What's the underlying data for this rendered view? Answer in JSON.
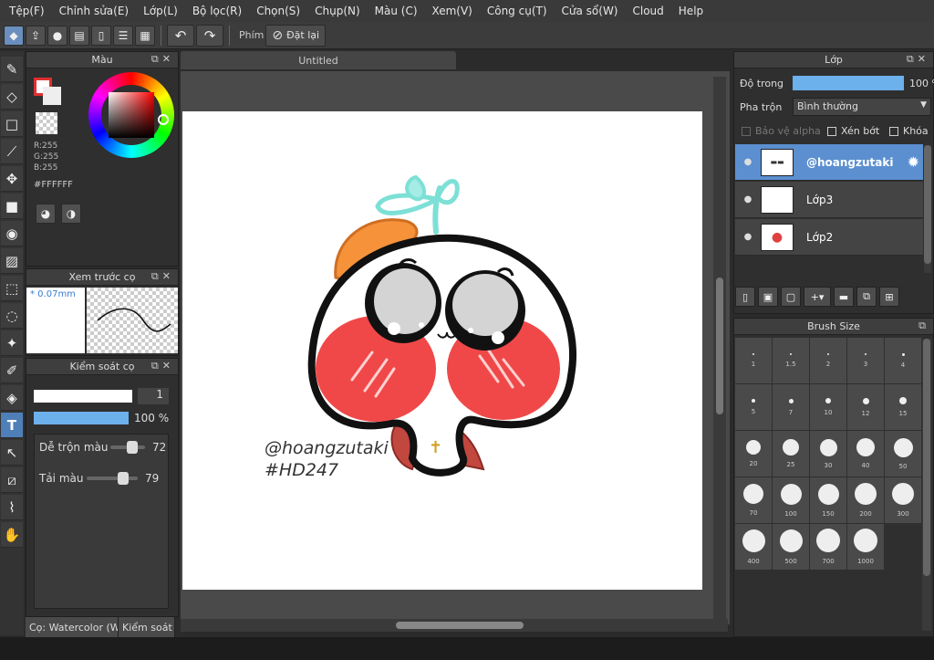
{
  "menu": [
    "Tệp(F)",
    "Chỉnh sửa(E)",
    "Lớp(L)",
    "Bộ lọc(R)",
    "Chọn(S)",
    "Chụp(N)",
    "Màu (C)",
    "Xem(V)",
    "Công cụ(T)",
    "Cửa sổ(W)",
    "Cloud",
    "Help"
  ],
  "toolbar": {
    "key_label": "Phím",
    "reset_label": "Đặt lại"
  },
  "color_panel": {
    "title": "Màu",
    "r": "R:255",
    "g": "G:255",
    "b": "B:255",
    "hex": "#FFFFFF"
  },
  "brush_preview": {
    "title": "Xem trước cọ",
    "size": "* 0.07mm"
  },
  "brush_control": {
    "title": "Kiểm soát cọ",
    "size_value": "1",
    "opacity_value": "100 %",
    "blend_label": "Dễ trộn màu",
    "blend_value": "72",
    "load_label": "Tải màu",
    "load_value": "79",
    "blend_level": 72,
    "load_level": 79
  },
  "bottom_tabs": [
    "Cọ: Watercolor (W...",
    "Kiểm soát c"
  ],
  "document": {
    "tab_title": "Untitled"
  },
  "artwork": {
    "handle": "@hoangzutaki",
    "tag": "#HD247"
  },
  "layer_panel": {
    "title": "Lớp",
    "opacity_label": "Độ trong",
    "opacity_value": "100 %",
    "blend_label": "Pha trộn",
    "blend_value": "Bình thường",
    "protect_alpha": "Bảo vệ alpha",
    "clipping": "Xén bớt",
    "lock": "Khóa",
    "layers": [
      {
        "name": "@hoangzutaki",
        "selected": true
      },
      {
        "name": "Lớp3",
        "selected": false
      },
      {
        "name": "Lớp2",
        "selected": false
      }
    ]
  },
  "brush_size": {
    "title": "Brush Size",
    "sizes": [
      "1",
      "1.5",
      "2",
      "3",
      "4",
      "5",
      "7",
      "10",
      "12",
      "15",
      "20",
      "25",
      "30",
      "40",
      "50",
      "70",
      "100",
      "150",
      "200",
      "300",
      "400",
      "500",
      "700",
      "1000"
    ]
  },
  "colors": {
    "accent": "#5b8fd0",
    "blush": "#f04848",
    "hat": "#f5923a",
    "sprout": "#7de0d6"
  }
}
